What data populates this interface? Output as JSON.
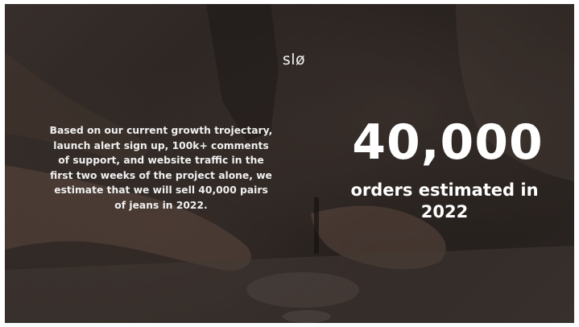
{
  "slide": {
    "logo": "slø",
    "body_text": "Based on our current growth trojectary, launch alert sign up, 100k+ comments of support, and website traffic in the first two weeks of the project alone, we estimate that we will sell 40,000 pairs of jeans in 2022.",
    "stat_number": "40,000",
    "stat_caption": "orders estimated in 2022",
    "background_image": "sewing-machine-hands-photo"
  }
}
